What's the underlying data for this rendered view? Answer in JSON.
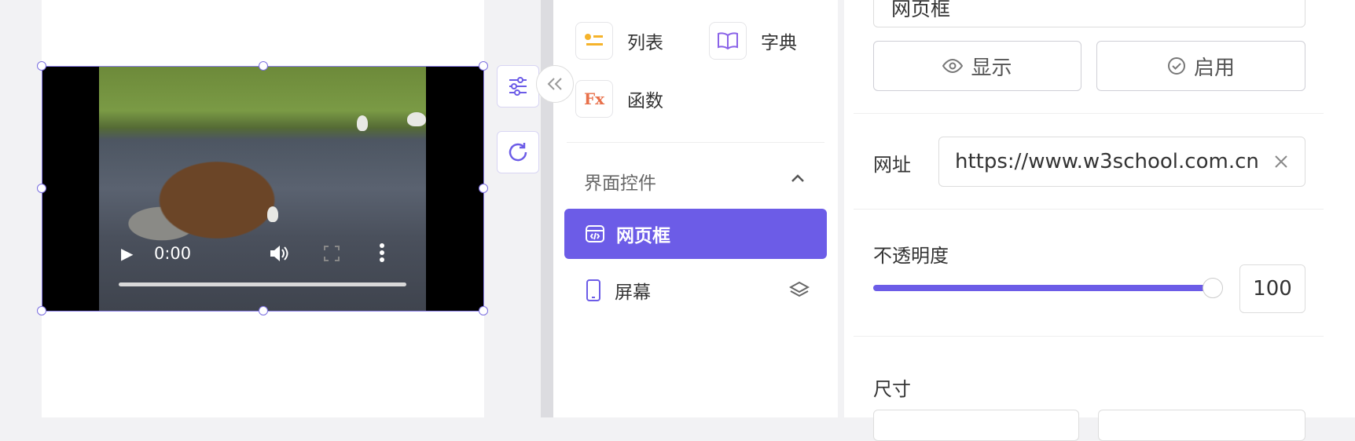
{
  "components": [
    {
      "label": "列表",
      "icon": "list-icon"
    },
    {
      "label": "字典",
      "icon": "book-icon"
    },
    {
      "label": "函数",
      "icon": "function-icon"
    }
  ],
  "section": {
    "title": "界面控件",
    "items": [
      {
        "label": "网页框",
        "icon": "webframe-icon",
        "active": true
      },
      {
        "label": "屏幕",
        "icon": "mobile-icon"
      }
    ]
  },
  "video": {
    "time": "0:00"
  },
  "props": {
    "name_value": "网页框",
    "show_label": "显示",
    "enable_label": "启用",
    "url_label": "网址",
    "url_value": "https://www.w3school.com.cn",
    "opacity_label": "不透明度",
    "opacity_value": "100",
    "opacity_fraction": 1.0,
    "size_label": "尺寸"
  },
  "colors": {
    "accent": "#6c5ce7"
  }
}
